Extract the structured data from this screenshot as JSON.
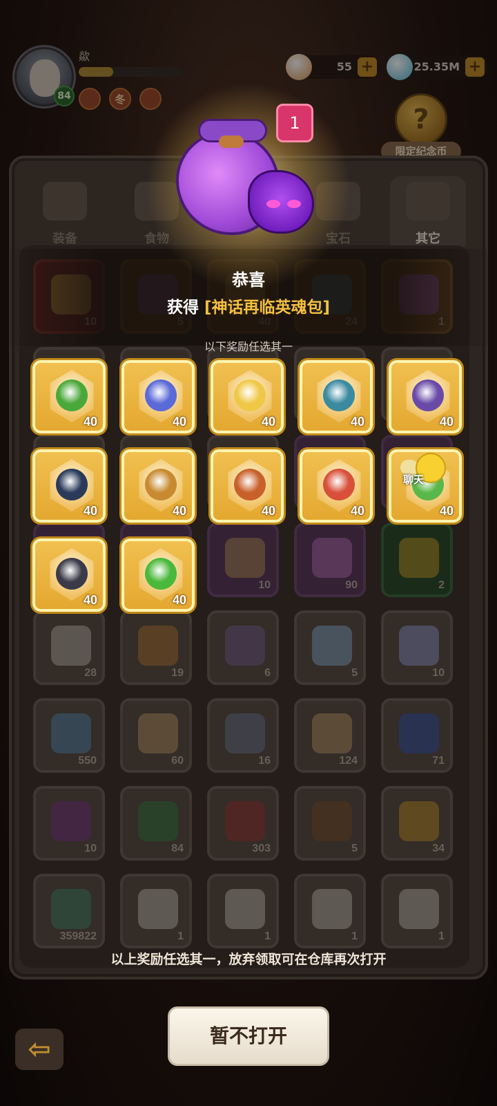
{
  "player": {
    "name": "歘",
    "level": "84",
    "exp_fraction": 0.33,
    "badges": [
      "",
      "冬",
      ""
    ]
  },
  "currencies": [
    {
      "name": "shell",
      "value": "55",
      "icon": "shell-icon",
      "color": "#e6b488"
    },
    {
      "name": "gem",
      "value": "25.35M",
      "icon": "blue-gem-icon",
      "color": "#8ad0e0"
    }
  ],
  "event": {
    "label": "限定纪念币",
    "coin_glyph": "?"
  },
  "tabs": [
    {
      "label": "装备",
      "icon": "equipment-icon",
      "active": false
    },
    {
      "label": "食物",
      "icon": "food-icon",
      "active": false
    },
    {
      "label": "宝石",
      "icon": "gemstone-icon",
      "active": false
    },
    {
      "label": "其它",
      "icon": "bone-icon",
      "active": true
    }
  ],
  "inventory": [
    {
      "count": "10",
      "tint": "red",
      "color": "#e0c050"
    },
    {
      "count": "5",
      "tint": "orange",
      "color": "#9a6ad8"
    },
    {
      "count": "40",
      "tint": "orange",
      "color": "#e6b040"
    },
    {
      "count": "24",
      "tint": "orange",
      "color": "#4aa0d8"
    },
    {
      "count": "1",
      "tint": "orange",
      "color": "#b060e0"
    },
    {
      "count": "",
      "tint": "",
      "color": "#7a6a5e"
    },
    {
      "count": "",
      "tint": "",
      "color": "#7a6a5e"
    },
    {
      "count": "",
      "tint": "",
      "color": "#7a6a5e"
    },
    {
      "count": "",
      "tint": "",
      "color": "#7a6a5e"
    },
    {
      "count": "",
      "tint": "",
      "color": "#7a6a5e"
    },
    {
      "count": "",
      "tint": "",
      "color": "#7a6a5e"
    },
    {
      "count": "",
      "tint": "",
      "color": "#7a6a5e"
    },
    {
      "count": "",
      "tint": "",
      "color": "#7a6a5e"
    },
    {
      "count": "",
      "tint": "purple",
      "color": "#7a6a5e"
    },
    {
      "count": "",
      "tint": "purple",
      "color": "#7a6a5e"
    },
    {
      "count": "",
      "tint": "purple",
      "color": "#7a6a5e"
    },
    {
      "count": "",
      "tint": "purple",
      "color": "#7a6a5e"
    },
    {
      "count": "10",
      "tint": "purple",
      "color": "#d0a060"
    },
    {
      "count": "90",
      "tint": "purple",
      "color": "#d080d0"
    },
    {
      "count": "2",
      "tint": "green",
      "color": "#e0b030"
    },
    {
      "count": "28",
      "tint": "",
      "color": "#d8d0c8"
    },
    {
      "count": "19",
      "tint": "",
      "color": "#d08a40"
    },
    {
      "count": "6",
      "tint": "",
      "color": "#8a70a8"
    },
    {
      "count": "5",
      "tint": "",
      "color": "#9ac8f0"
    },
    {
      "count": "10",
      "tint": "",
      "color": "#a8b0f0"
    },
    {
      "count": "550",
      "tint": "",
      "color": "#60a0d0"
    },
    {
      "count": "60",
      "tint": "",
      "color": "#d8b078"
    },
    {
      "count": "16",
      "tint": "",
      "color": "#7a88a8"
    },
    {
      "count": "124",
      "tint": "",
      "color": "#d8b078"
    },
    {
      "count": "71",
      "tint": "",
      "color": "#3a60c8"
    },
    {
      "count": "10",
      "tint": "",
      "color": "#8a3a9a"
    },
    {
      "count": "84",
      "tint": "",
      "color": "#3a8a4a"
    },
    {
      "count": "303",
      "tint": "",
      "color": "#b03a3a"
    },
    {
      "count": "5",
      "tint": "",
      "color": "#8a5a30"
    },
    {
      "count": "34",
      "tint": "",
      "color": "#e0a830"
    },
    {
      "count": "359822",
      "tint": "",
      "color": "#4a9a7a"
    },
    {
      "count": "1",
      "tint": "",
      "color": "#e0d8d0"
    },
    {
      "count": "1",
      "tint": "",
      "color": "#e0d8d0"
    },
    {
      "count": "1",
      "tint": "",
      "color": "#e0d8d0"
    },
    {
      "count": "1",
      "tint": "",
      "color": "#e0d8d0"
    }
  ],
  "popup": {
    "quantity": "1",
    "title": "恭喜",
    "obtained_prefix": "获得",
    "item_name": "[神话再临英魂包]",
    "hint": "以下奖励任选其一",
    "rewards": [
      {
        "count": "40",
        "color": "#4aa83a"
      },
      {
        "count": "40",
        "color": "#5a6ad8"
      },
      {
        "count": "40",
        "color": "#f0c848"
      },
      {
        "count": "40",
        "color": "#3a8aa0"
      },
      {
        "count": "40",
        "color": "#6a4aa8"
      },
      {
        "count": "40",
        "color": "#2a3a5a"
      },
      {
        "count": "40",
        "color": "#c88a30"
      },
      {
        "count": "40",
        "color": "#c8602a"
      },
      {
        "count": "40",
        "color": "#d8503a"
      },
      {
        "count": "40",
        "color": "#5ab84a"
      },
      {
        "count": "40",
        "color": "#3a3a48"
      },
      {
        "count": "40",
        "color": "#4ab83a"
      }
    ]
  },
  "chat": {
    "label": "聊天"
  },
  "footer_note": "以上奖励任选其一，放弃领取可在仓库再次打开",
  "close_button": "暂不打开"
}
